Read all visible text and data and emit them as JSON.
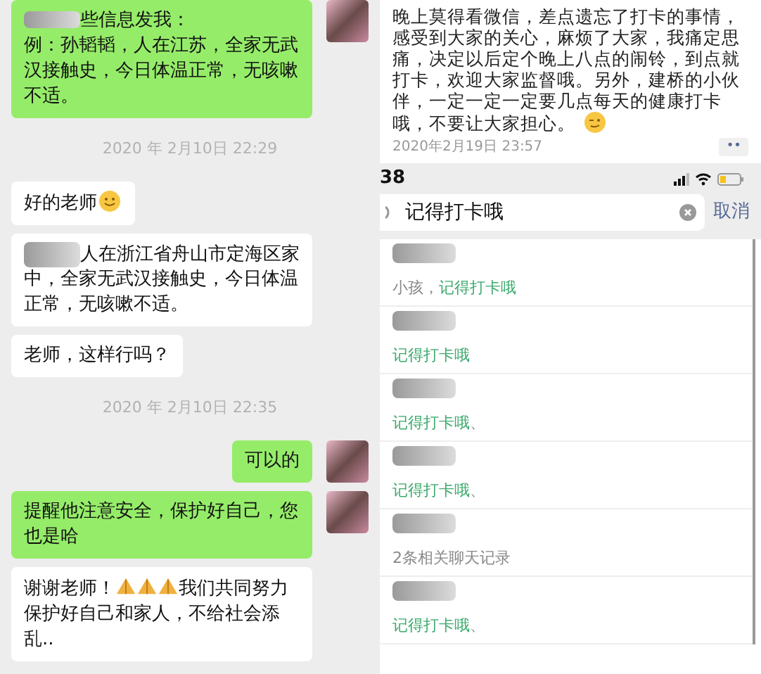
{
  "chat": {
    "messages": [
      {
        "kind": "sent",
        "redacted": true,
        "parts": [
          {
            "kind": "text",
            "text": "些信息发我："
          },
          {
            "kind": "break"
          },
          {
            "kind": "text",
            "text": "例：孙韬韬，人在江苏，全家无武汉接触史，今日体温正常，无咳嗽不适。"
          }
        ]
      },
      {
        "kind": "time",
        "text": "2020 年 2月10日 22:29"
      },
      {
        "kind": "received",
        "redacted": false,
        "parts": [
          {
            "kind": "text",
            "text": "好的老师"
          },
          {
            "kind": "smile"
          }
        ]
      },
      {
        "kind": "received",
        "redacted": true,
        "parts": [
          {
            "kind": "text",
            "text": "人在浙江省舟山市定海区家中，全家无武汉接触史，今日体温正常，无咳嗽不适。"
          }
        ]
      },
      {
        "kind": "received",
        "redacted": false,
        "parts": [
          {
            "kind": "text",
            "text": "老师，这样行吗？"
          }
        ]
      },
      {
        "kind": "time",
        "text": "2020 年 2月10日 22:35"
      },
      {
        "kind": "sent",
        "redacted": false,
        "parts": [
          {
            "kind": "text",
            "text": "可以的"
          }
        ]
      },
      {
        "kind": "sent",
        "redacted": false,
        "parts": [
          {
            "kind": "text",
            "text": "提醒他注意安全，保护好自己，您也是哈"
          }
        ]
      },
      {
        "kind": "received",
        "redacted": false,
        "parts": [
          {
            "kind": "text",
            "text": "谢谢老师！"
          },
          {
            "kind": "pray"
          },
          {
            "kind": "pray"
          },
          {
            "kind": "pray"
          },
          {
            "kind": "text",
            "text": "我们共同努力保护好自己和家人，不给社会添乱.."
          }
        ]
      }
    ]
  },
  "post": {
    "parts": [
      {
        "kind": "text",
        "text": "晚上莫得看微信，差点遗忘了打卡的事情，感受到大家的关心，麻烦了大家，我痛定思痛，决定以后定个晚上八点的闹铃，到点就打卡，欢迎大家监督哦。另外，建桥的小伙伴，一定一定一定要几点每天的健康打卡哦，不要让大家担心。"
      },
      {
        "kind": "wink"
      }
    ],
    "time": "2020年2月19日 23:57",
    "more": "••"
  },
  "status_bar": {
    "time": "38"
  },
  "search": {
    "value": "记得打卡哦",
    "cancel": "取消"
  },
  "results": [
    {
      "segments": [
        {
          "text": "小孩，",
          "highlight": false
        },
        {
          "text": "记得打卡哦",
          "highlight": true
        }
      ]
    },
    {
      "segments": [
        {
          "text": "记得打卡哦",
          "highlight": true
        }
      ]
    },
    {
      "segments": [
        {
          "text": "记得打卡哦",
          "highlight": true
        },
        {
          "text": "、",
          "highlight": false
        }
      ]
    },
    {
      "segments": [
        {
          "text": "记得打卡哦",
          "highlight": true
        },
        {
          "text": "、",
          "highlight": false
        }
      ]
    },
    {
      "segments": [
        {
          "text": "2条相关聊天记录",
          "highlight": false
        }
      ]
    },
    {
      "segments": [
        {
          "text": "记得打卡哦",
          "highlight": true
        },
        {
          "text": "、",
          "highlight": false
        }
      ]
    }
  ]
}
